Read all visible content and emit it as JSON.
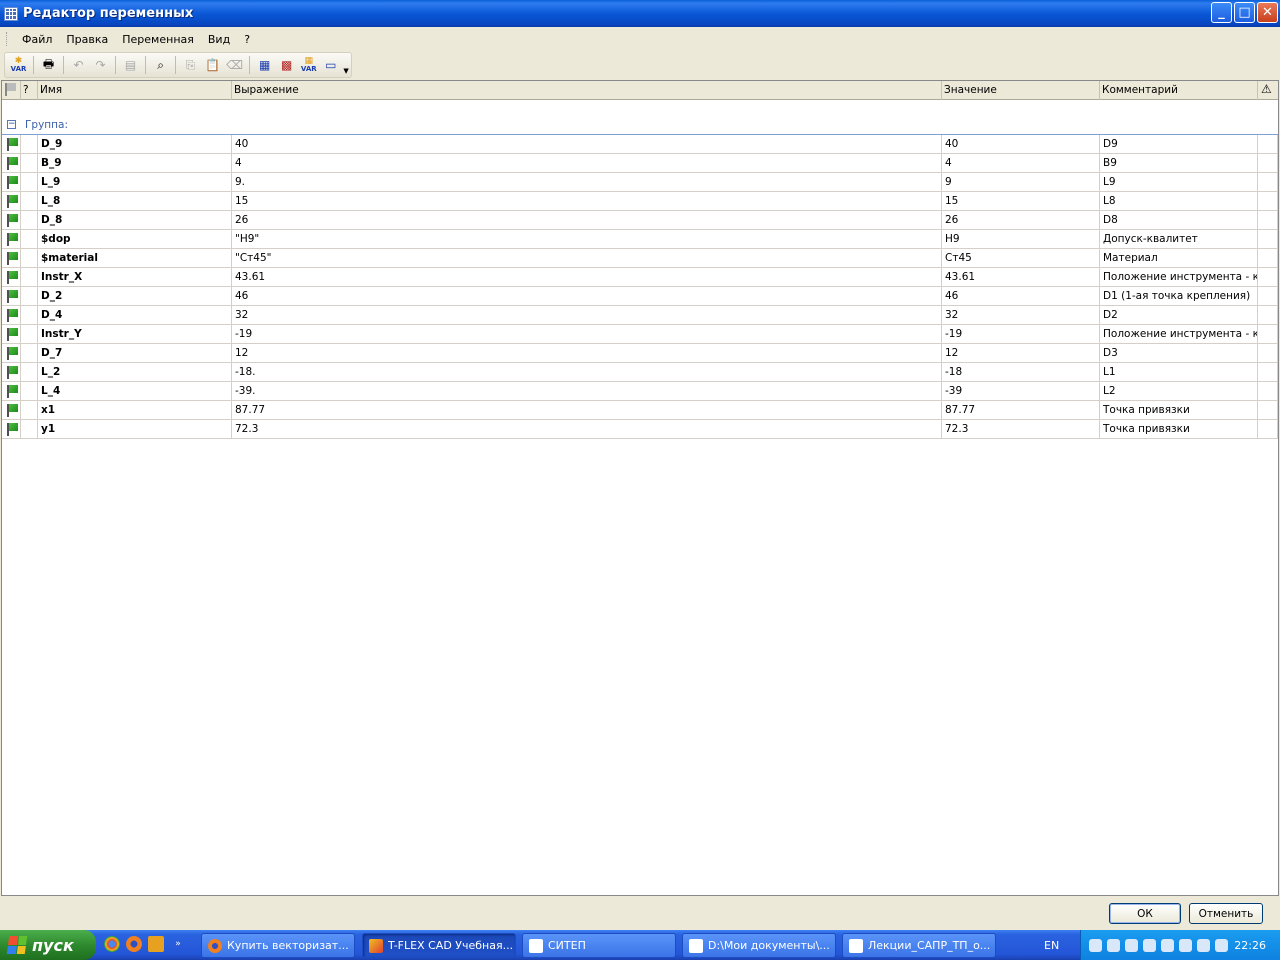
{
  "window": {
    "title": "Редактор переменных"
  },
  "menu": [
    "Файл",
    "Правка",
    "Переменная",
    "Вид",
    "?"
  ],
  "toolbar": {
    "var_label": "VAR",
    "var2_label": "VAR"
  },
  "columns": {
    "q": "?",
    "name": "Имя",
    "expression": "Выражение",
    "value": "Значение",
    "comment": "Комментарий"
  },
  "group": {
    "label": "Группа:",
    "collapse_glyph": "−"
  },
  "rows": [
    {
      "name": "D_9",
      "expression": "40",
      "value": "40",
      "comment": "D9"
    },
    {
      "name": "B_9",
      "expression": "4",
      "value": "4",
      "comment": "B9"
    },
    {
      "name": "L_9",
      "expression": "9.",
      "value": "9",
      "comment": "L9"
    },
    {
      "name": "L_8",
      "expression": "15",
      "value": "15",
      "comment": "L8"
    },
    {
      "name": "D_8",
      "expression": "26",
      "value": "26",
      "comment": "D8"
    },
    {
      "name": "$dop",
      "expression": "\"H9\"",
      "value": "H9",
      "comment": "Допуск-квалитет"
    },
    {
      "name": "$material",
      "expression": "\"Ст45\"",
      "value": "Ст45",
      "comment": "Материал"
    },
    {
      "name": "Instr_X",
      "expression": "43.61",
      "value": "43.61",
      "comment": "Положение инструмента - ко..."
    },
    {
      "name": "D_2",
      "expression": "46",
      "value": "46",
      "comment": "D1 (1-ая точка крепления)"
    },
    {
      "name": "D_4",
      "expression": "32",
      "value": "32",
      "comment": "D2"
    },
    {
      "name": "Instr_Y",
      "expression": "-19",
      "value": "-19",
      "comment": "Положение инструмента - ко..."
    },
    {
      "name": "D_7",
      "expression": "12",
      "value": "12",
      "comment": "D3"
    },
    {
      "name": "L_2",
      "expression": "-18.",
      "value": "-18",
      "comment": "L1"
    },
    {
      "name": "L_4",
      "expression": "-39.",
      "value": "-39",
      "comment": "L2"
    },
    {
      "name": "x1",
      "expression": "87.77",
      "value": "87.77",
      "comment": "Точка привязки"
    },
    {
      "name": "y1",
      "expression": "72.3",
      "value": "72.3",
      "comment": "Точка привязки"
    }
  ],
  "buttons": {
    "ok": "ОК",
    "cancel": "Отменить"
  },
  "taskbar": {
    "start": "пуск",
    "tasks": [
      "Купить векторизат...",
      "T-FLEX CAD Учебная...",
      "СИТЕП",
      "D:\\Мои документы\\...",
      "Лекции_САПР_ТП_о..."
    ],
    "language": "EN",
    "clock": "22:26"
  }
}
